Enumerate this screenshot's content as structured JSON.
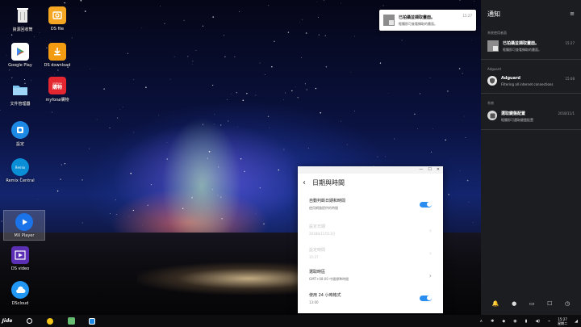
{
  "desktop": {
    "icons": [
      {
        "label": "資源回收筒",
        "icon": "recycle-bin-icon"
      },
      {
        "label": "DS file",
        "icon": "ds-file-icon"
      },
      {
        "label": "Google Play",
        "icon": "google-play-icon"
      },
      {
        "label": "DS download",
        "icon": "ds-download-icon"
      },
      {
        "label": "文件管理器",
        "icon": "folder-icon"
      },
      {
        "label": "myfone購物",
        "icon": "myfone-icon",
        "badge": "購物",
        "brand": "myfone"
      },
      {
        "label": "設定",
        "icon": "settings-icon"
      },
      {
        "label": "Remix Central",
        "icon": "remix-central-icon",
        "badge": "Remix"
      },
      {
        "label": "MX Player",
        "icon": "mx-player-icon"
      },
      {
        "label": "DS video",
        "icon": "ds-video-icon"
      },
      {
        "label": "DScloud",
        "icon": "ds-cloud-icon"
      }
    ]
  },
  "toast": {
    "title": "已拍攝並擷取畫面。",
    "subtitle": "輕觸即可查看擷取的畫面。",
    "time": "15:27"
  },
  "settings_window": {
    "titlebar": {
      "minimize": "—",
      "maximize": "☐",
      "close": "✕"
    },
    "back": "‹",
    "title": "日期與時間",
    "rows": [
      {
        "title": "自動判斷日期和時間",
        "subtitle": "使用網路提供的時間",
        "control": "toggle",
        "on": true,
        "enabled": true
      },
      {
        "title": "設定日期",
        "subtitle": "2018年11月13日",
        "control": "chevron",
        "enabled": false
      },
      {
        "title": "設定時間",
        "subtitle": "15:27",
        "control": "chevron",
        "enabled": false
      },
      {
        "title": "選取時區",
        "subtitle": "GMT+08:00 中國標準時間",
        "control": "chevron",
        "enabled": true
      },
      {
        "title": "使用 24 小時格式",
        "subtitle": "13:00",
        "control": "toggle",
        "on": true,
        "enabled": true
      }
    ]
  },
  "notification_panel": {
    "title": "通知",
    "menu_icon": "≡",
    "sections": [
      {
        "label": "系統使用者面",
        "items": [
          {
            "icon": "screenshot-icon",
            "title": "已拍攝並擷取畫面。",
            "subtitle": "輕觸即可查看擷取的畫面。",
            "time": "15:27"
          }
        ]
      },
      {
        "label": "Adguard",
        "items": [
          {
            "icon": "adguard-shield-icon",
            "title": "Adguard",
            "subtitle": "Filtering all internet connections",
            "time": "15:08"
          }
        ]
      },
      {
        "label": "系統",
        "items": [
          {
            "icon": "keyboard-icon",
            "title": "選取鍵盤配置",
            "subtitle": "輕觸即可選取鍵盤配置",
            "time": "2018/11/1"
          }
        ]
      }
    ],
    "quick_actions": [
      {
        "icon": "bell-icon",
        "glyph": "🔔"
      },
      {
        "icon": "location-icon",
        "glyph": "●"
      },
      {
        "icon": "screen-icon",
        "glyph": "▭"
      },
      {
        "icon": "window-icon",
        "glyph": "☐"
      },
      {
        "icon": "clock-icon",
        "glyph": "◷"
      }
    ]
  },
  "taskbar": {
    "start_label": "Jide",
    "apps": [
      {
        "icon": "circle-app-icon"
      },
      {
        "icon": "coin-app-icon"
      },
      {
        "icon": "adguard-app-icon"
      },
      {
        "icon": "settings-app-icon"
      }
    ],
    "tray": [
      "∧",
      "✱",
      "◆",
      "◉",
      "▮",
      "◀)",
      "⌁"
    ],
    "clock_time": "15:27",
    "clock_day": "星期二",
    "corner": "◢"
  },
  "colors": {
    "accent": "#2a8ef0",
    "panel_bg": "#1c1d21",
    "taskbar_bg": "#0d0d0f"
  }
}
